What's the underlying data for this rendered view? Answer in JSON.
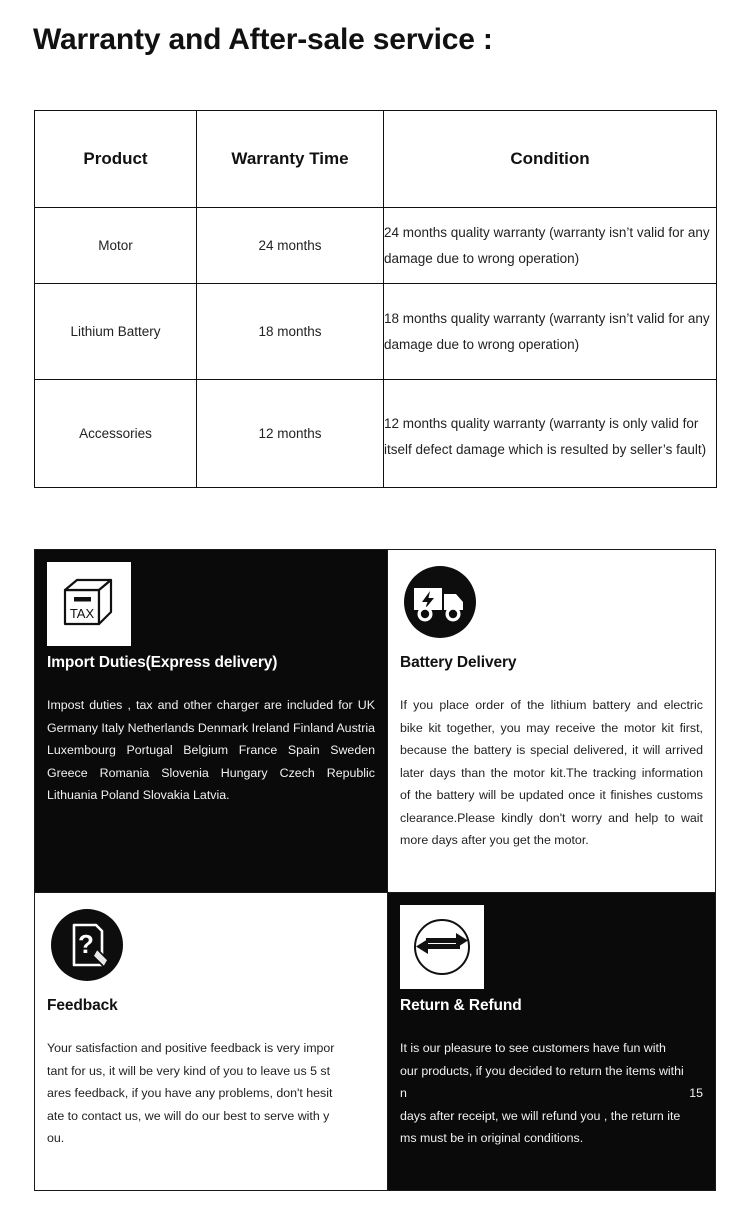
{
  "page": {
    "title": "Warranty and After-sale service :"
  },
  "warranty_table": {
    "headers": [
      "Product",
      "Warranty Time",
      "Condition"
    ],
    "rows": [
      {
        "product": "Motor",
        "time": "24 months",
        "condition": "24 months quality warranty (warranty isn’t valid for any damage due to wrong operation)"
      },
      {
        "product": "Lithium Battery",
        "time": "18 months",
        "condition": "18 months quality warranty (warranty isn’t valid for any damage due to wrong operation)"
      },
      {
        "product": "Accessories",
        "time": "12 months",
        "condition": "12 months quality warranty (warranty is only valid for itself defect damage which is resulted by seller’s fault)"
      }
    ]
  },
  "info_panels": {
    "import_duties": {
      "icon": "tax-box-icon",
      "title": "Import Duties(Express delivery)",
      "body": "Impost duties , tax and other charger are included for UK Germany Italy Netherlands Denmark Ireland Finland Austria Luxembourg Portugal Belgium France Spain Sweden Greece Romania Slovenia Hungary Czech Republic Lithuania Poland Slovakia Latvia."
    },
    "battery_delivery": {
      "icon": "electric-delivery-truck-icon",
      "title": "Battery Delivery",
      "body": "If you place order of the lithium battery and electric bike kit together, you may receive the motor kit first, because the battery is special delivered, it will arrived later days than the motor kit.The tracking information of the battery will be updated once it finishes customs clearance.Please kindly don't worry and help to wait more days after you get the motor."
    },
    "feedback": {
      "icon": "document-question-pencil-icon",
      "title": "Feedback",
      "body_lines": [
        "Your satisfaction and positive feedback is very impor",
        "tant for us, it will be very kind of you to leave us 5 st",
        "ares feedback, if you have any problems, don't hesit",
        "ate to contact us, we will do our best to serve with y",
        "ou."
      ]
    },
    "return_refund": {
      "icon": "exchange-arrows-icon",
      "title": "Return & Refund",
      "body_lines": [
        "It is our pleasure to see customers have fun with",
        "our products, if you decided to return the items withi",
        "n",
        "days after receipt, we will refund you , the return ite",
        "ms must be in original conditions."
      ],
      "days_value": "15"
    }
  },
  "colors": {
    "dark_panel": "#0a0a0a",
    "light_panel": "#ffffff",
    "border": "#1a1a1a",
    "text_dark": "#111111",
    "text_light": "#f2f2f2"
  }
}
